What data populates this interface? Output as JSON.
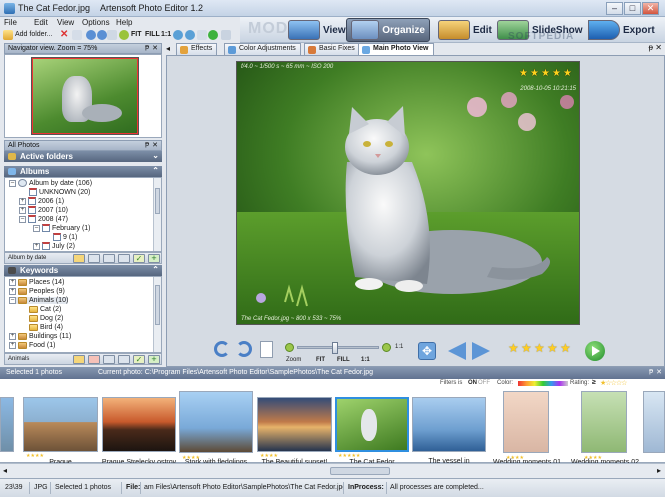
{
  "window": {
    "file_title": "The Cat Fedor.jpg",
    "app_title": "Artensoft Photo Editor 1.2"
  },
  "menu": [
    "File",
    "Edit",
    "View",
    "Options",
    "Help"
  ],
  "toolbar": {
    "add_folder": "Add folder...",
    "fit": "FIT",
    "fill": "FILL",
    "one_to_one": "1:1"
  },
  "modes": {
    "label": "MODE:",
    "items": [
      {
        "label": "View"
      },
      {
        "label": "Organize",
        "active": true
      },
      {
        "label": "Edit"
      },
      {
        "label": "SlideShow"
      },
      {
        "label": "Export"
      }
    ]
  },
  "watermark": "SOFTPEDIA",
  "navigator": {
    "title": "Navigator view. Zoom = 75%"
  },
  "all_photos": {
    "title": "All Photos",
    "active_folders": "Active folders",
    "albums": "Albums",
    "album_tree": [
      {
        "label": "Album by date (106)"
      },
      {
        "label": "UNKNOWN (20)"
      },
      {
        "label": "2006 (1)"
      },
      {
        "label": "2007 (10)"
      },
      {
        "label": "2008 (47)"
      },
      {
        "label": "February (1)"
      },
      {
        "label": "9 (1)"
      },
      {
        "label": "July (2)"
      }
    ],
    "album_strip_label": "Album by date",
    "keywords": "Keywords",
    "keyword_tree": [
      {
        "label": "Places (14)"
      },
      {
        "label": "Peoples (9)"
      },
      {
        "label": "Animals (10)"
      },
      {
        "label": "Cat  (2)"
      },
      {
        "label": "Dog  (2)"
      },
      {
        "label": "Bird  (4)"
      },
      {
        "label": "Buildings (11)"
      },
      {
        "label": "Food  (1)"
      }
    ],
    "keyword_strip_label": "Animals"
  },
  "tabs": [
    {
      "label": "Effects"
    },
    {
      "label": "Color Adjustments"
    },
    {
      "label": "Basic Fixes"
    },
    {
      "label": "Main Photo View",
      "active": true
    }
  ],
  "photo": {
    "exif": "f/4.0 ~ 1/500 s ~ 65 mm ~ ISO 200",
    "date": "2008-10-05 10:21:15",
    "caption": "The Cat Fedor.jpg ~ 800 x 533 ~ 75%",
    "rating": 5
  },
  "zoom_controls": {
    "zoom": "Zoom",
    "fit": "FIT",
    "fill": "FILL",
    "one_to_one": "1:1",
    "ratio": "1:1",
    "zoom_level": 0.45
  },
  "rating_controls": {
    "rating": 5
  },
  "filmstrip": {
    "selected": "Selected 1 photos",
    "current": "Current photo: C:\\Program Files\\Artensoft Photo Editor\\SamplePhotos\\The Cat Fedor.jpg",
    "filters": "Filters is",
    "filter_on": "ON",
    "filter_off": "OFF",
    "color": "Color:",
    "rating": "Rating:",
    "thumbnails": [
      {
        "caption": "Prague"
      },
      {
        "caption": "Prague Strelecky ostrov"
      },
      {
        "caption": "Stork with fledglings"
      },
      {
        "caption": "The Beautiful sunset!"
      },
      {
        "caption": "The Cat Fedor",
        "selected": true
      },
      {
        "caption": "The vessel in"
      },
      {
        "caption": "Wedding moments 01"
      },
      {
        "caption": "Wedding moments 02"
      }
    ]
  },
  "status": {
    "count": "23\\39",
    "format": "JPG",
    "selected": "Selected 1 photos",
    "file_label": "File:",
    "file_path": "am Files\\Artensoft Photo Editor\\SamplePhotos\\The Cat Fedor.jpg",
    "inprocess_label": "InProcess:",
    "inprocess_value": "All processes are completed..."
  }
}
